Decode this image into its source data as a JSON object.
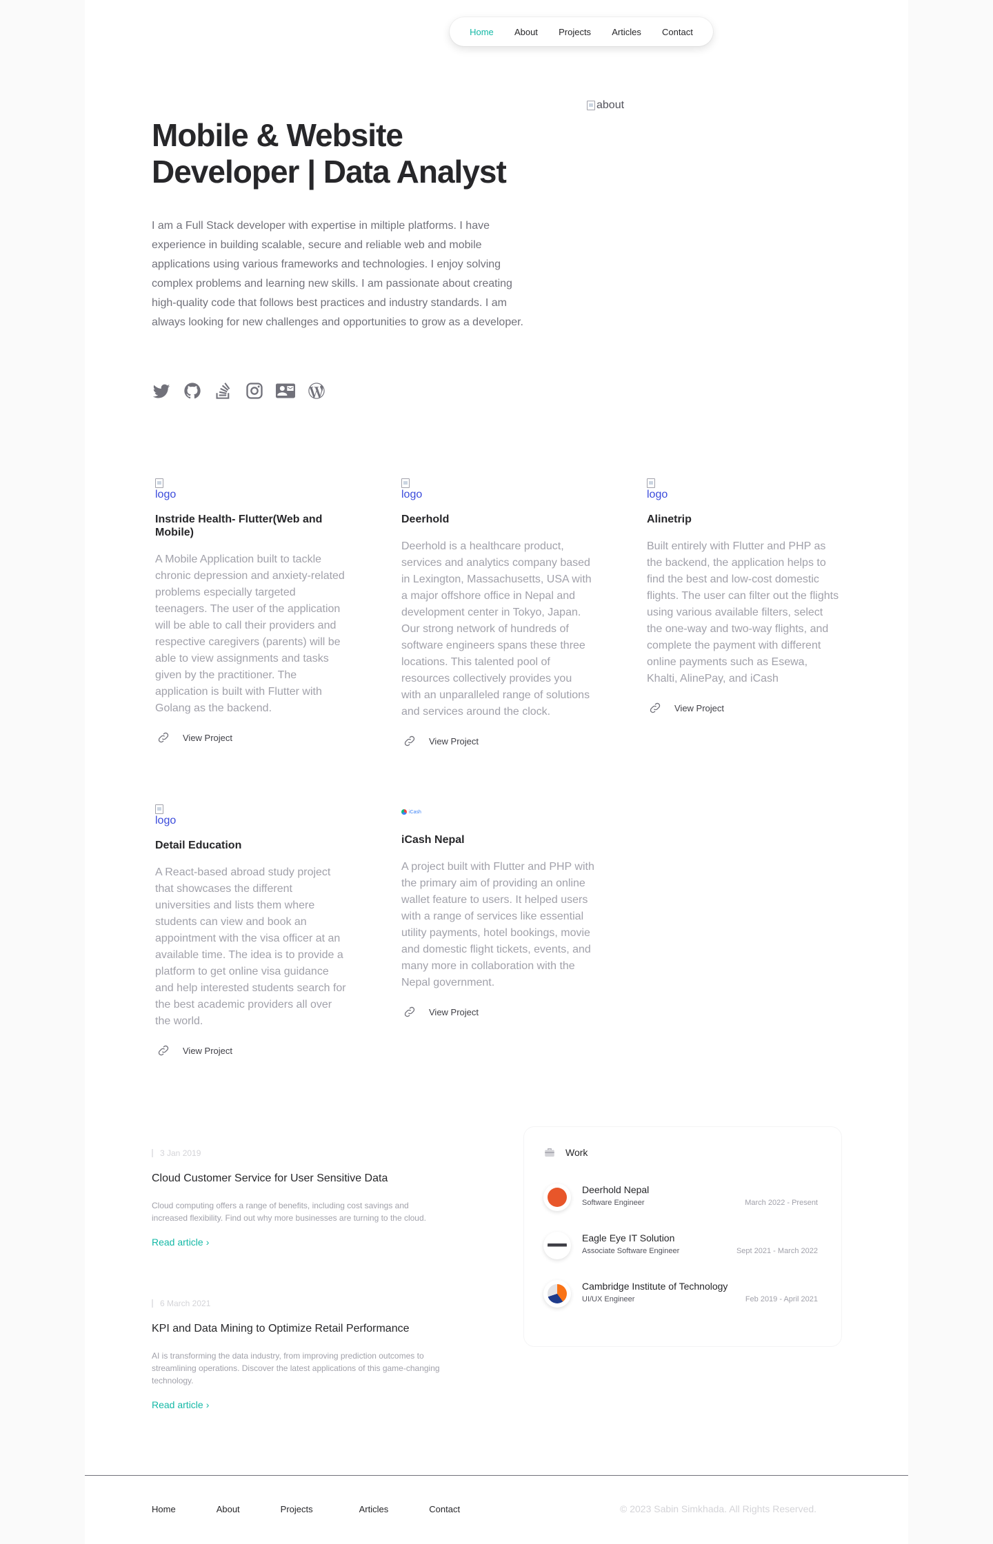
{
  "nav": {
    "items": [
      "Home",
      "About",
      "Projects",
      "Articles",
      "Contact"
    ],
    "active": "Home"
  },
  "hero": {
    "title": "Mobile & Website Developer | Data Analyst",
    "description": "I am a Full Stack developer with expertise in miltiple platforms. I have experience in building scalable, secure and reliable web and mobile applications using various frameworks and technologies. I enjoy solving complex problems and learning new skills. I am passionate about creating high-quality code that follows best practices and industry standards. I am always looking for new challenges and opportunities to grow as a developer.",
    "image_alt": "about",
    "socials": [
      "twitter-icon",
      "github-icon",
      "stackoverflow-icon",
      "instagram-icon",
      "mail-stack-icon",
      "wordpress-icon"
    ]
  },
  "projects": [
    {
      "logo_alt": "logo",
      "title": "Instride Health- Flutter(Web and Mobile)",
      "description": "A Mobile Application built to tackle chronic depression and anxiety-related problems especially targeted teenagers. The user of the application will be able to call their providers and respective caregivers (parents) will be able to view assignments and tasks given by the practitioner. The application is built with Flutter with Golang as the backend.",
      "link": "View Project"
    },
    {
      "logo_alt": "logo",
      "title": "Deerhold",
      "description": "Deerhold is a healthcare product, services and analytics company based in Lexington, Massachusetts, USA with a major offshore office in Nepal and development center in Tokyo, Japan. Our strong network of hundreds of software engineers spans these three locations. This talented pool of resources collectively provides you with an unparalleled range of solutions and services around the clock.",
      "link": "View Project"
    },
    {
      "logo_alt": "logo",
      "title": "Alinetrip",
      "description": "Built entirely with Flutter and PHP as the backend, the application helps to find the best and low-cost domestic flights. The user can filter out the flights using various available filters, select the one-way and two-way flights, and complete the payment with different online payments such as Esewa, Khalti, AlinePay, and iCash",
      "link": "View Project"
    },
    {
      "logo_alt": "logo",
      "title": "Detail Education",
      "description": "A React-based abroad study project that showcases the different universities and lists them where students can view and book an appointment with the visa officer at an available time. The idea is to provide a platform to get online visa guidance and help interested students search for the best academic providers all over the world.",
      "link": "View Project"
    },
    {
      "logo_text": "iCash",
      "title": "iCash Nepal",
      "description": "A project built with Flutter and PHP with the primary aim of providing an online wallet feature to users. It helped users with a range of services like essential utility payments, hotel bookings, movie and domestic flight tickets, events, and many more in collaboration with the Nepal government.",
      "link": "View Project"
    }
  ],
  "articles": [
    {
      "date": "3 Jan 2019",
      "title": "Cloud Customer Service for User Sensitive Data",
      "summary": "Cloud computing offers a range of benefits, including cost savings and increased flexibility. Find out why more businesses are turning to the cloud.",
      "cta": "Read article"
    },
    {
      "date": "6 March 2021",
      "title": "KPI and Data Mining to Optimize Retail Performance",
      "summary": "AI is transforming the data industry, from improving prediction outcomes to streamlining operations. Discover the latest applications of this game-changing technology.",
      "cta": "Read article"
    }
  ],
  "work": {
    "heading": "Work",
    "jobs": [
      {
        "company": "Deerhold Nepal",
        "role": "Software Engineer",
        "period": "March 2022 - Present",
        "color": "#e8562a"
      },
      {
        "company": "Eagle Eye IT Solution",
        "role": "Associate Software Engineer",
        "period": "Sept 2021 - March 2022",
        "color": "#3f3f46"
      },
      {
        "company": "Cambridge Institute of Technology",
        "role": "UI/UX Engineer",
        "period": "Feb 2019 - April 2021",
        "color": "#f97316"
      }
    ]
  },
  "footer": {
    "links": [
      "Home",
      "About",
      "Projects",
      "Articles",
      "Contact"
    ],
    "copyright": "© 2023 Sabin Simkhada. All Rights Reserved."
  },
  "colors": {
    "accent": "#14b8a6",
    "text": "#27272a",
    "muted": "#a1a1aa",
    "link_logo": "#3b4bdb"
  }
}
